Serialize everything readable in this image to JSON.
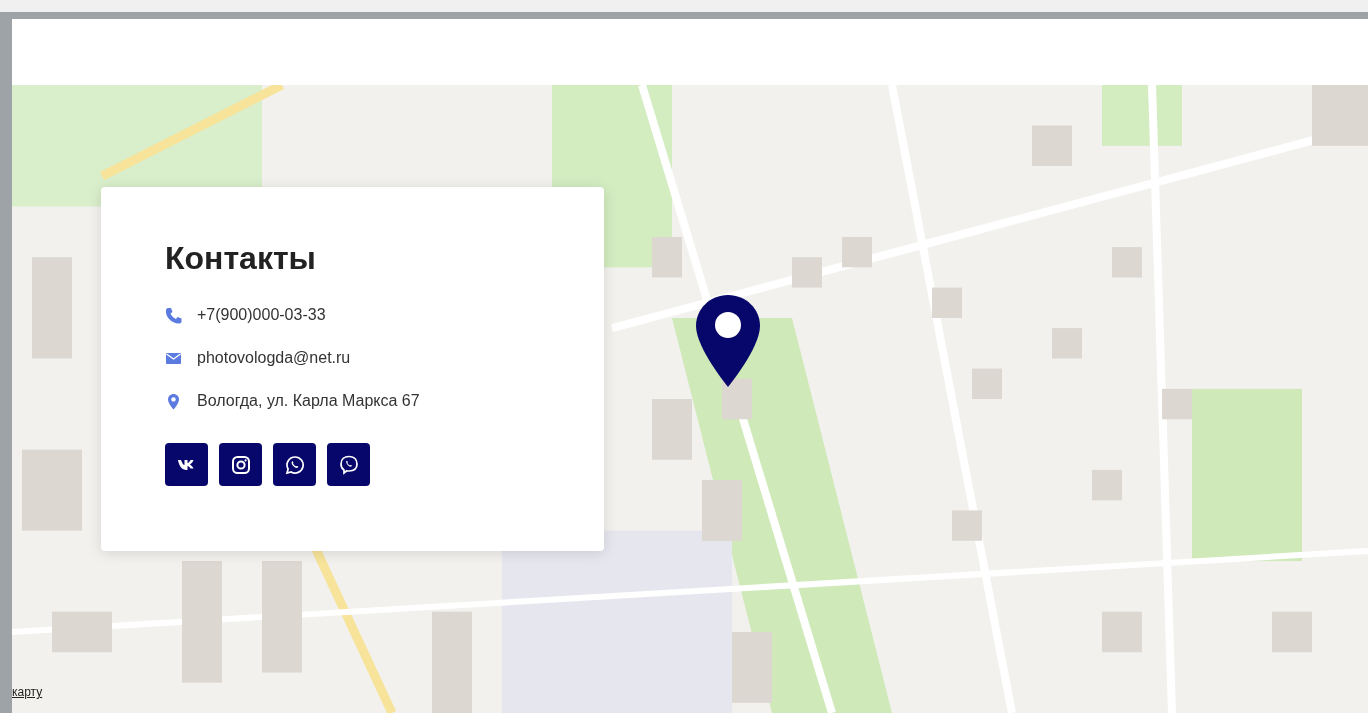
{
  "contacts": {
    "title": "Контакты",
    "items": [
      {
        "kind": "phone",
        "text": "+7(900)000-03-33"
      },
      {
        "kind": "email",
        "text": "photovologda@net.ru"
      },
      {
        "kind": "address",
        "text": "Вологда, ул. Карла Маркса 67"
      }
    ],
    "social": [
      {
        "kind": "vk"
      },
      {
        "kind": "instagram"
      },
      {
        "kind": "whatsapp"
      },
      {
        "kind": "viber"
      }
    ]
  },
  "map": {
    "link": "карту"
  }
}
